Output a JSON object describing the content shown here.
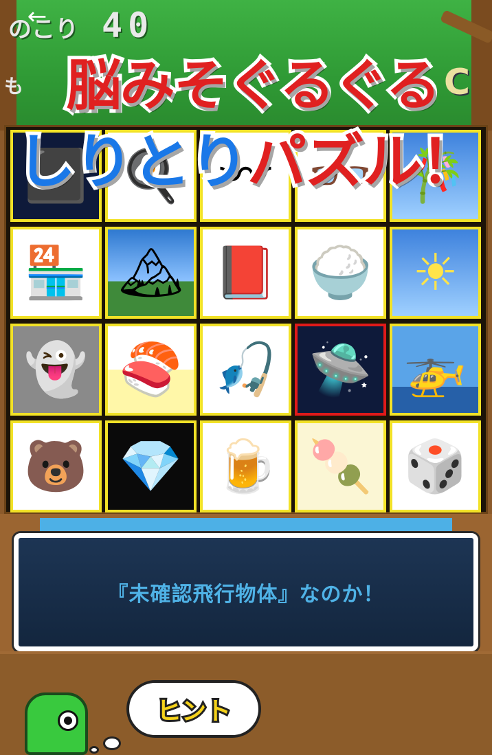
{
  "header": {
    "remaining_label": "のこり",
    "remaining_count": "40",
    "sub_label": "も",
    "score_letter": "C",
    "back_icon": "back-arrow-icon"
  },
  "banner": {
    "line1": "脳みそぐるぐる",
    "line2_blue": "しりとり",
    "line2_red": "パズル！"
  },
  "board": {
    "cells": [
      {
        "icon": "square-photo",
        "glyph": "⬛"
      },
      {
        "icon": "food-plate",
        "glyph": "🍳"
      },
      {
        "icon": "rope",
        "glyph": "〰"
      },
      {
        "icon": "glasses",
        "glyph": "👓"
      },
      {
        "icon": "bamboo",
        "glyph": "🎋"
      },
      {
        "icon": "convenience-store",
        "glyph": "🏪"
      },
      {
        "icon": "mountain",
        "glyph": "🏔"
      },
      {
        "icon": "book",
        "glyph": "📕"
      },
      {
        "icon": "rice-bowl",
        "glyph": "🍚"
      },
      {
        "icon": "sun",
        "glyph": "☀"
      },
      {
        "icon": "ghost",
        "glyph": "👻"
      },
      {
        "icon": "sushi-roll",
        "glyph": "🍣"
      },
      {
        "icon": "fishing-rod",
        "glyph": "🎣"
      },
      {
        "icon": "ufo",
        "glyph": "🛸"
      },
      {
        "icon": "helicopter",
        "glyph": "🚁"
      },
      {
        "icon": "bear",
        "glyph": "🐻"
      },
      {
        "icon": "diamond",
        "glyph": "💎"
      },
      {
        "icon": "beer",
        "glyph": "🍺"
      },
      {
        "icon": "dango-skewer",
        "glyph": "🍡"
      },
      {
        "icon": "dice",
        "glyph": "🎲"
      }
    ],
    "selected_index": 13
  },
  "message": {
    "text": "『未確認飛行物体』なのか！"
  },
  "hint": {
    "label": "ヒント"
  },
  "colors": {
    "cell_border": "#f2e227",
    "selected_border": "#e01a1a",
    "banner_red": "#e02020",
    "banner_blue": "#1a78e8",
    "message_text": "#4fb2e6"
  }
}
